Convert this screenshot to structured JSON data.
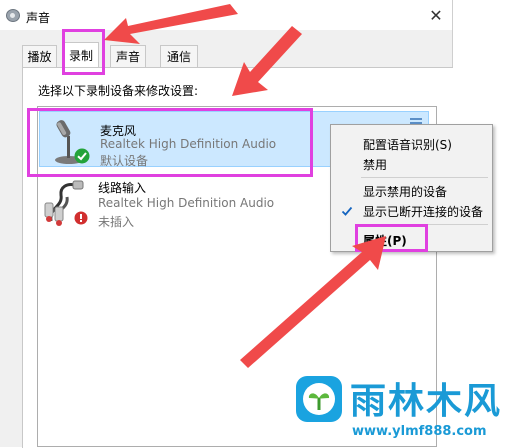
{
  "window": {
    "title": "声音",
    "close_glyph": "✕"
  },
  "tabs": [
    {
      "label": "播放",
      "active": false
    },
    {
      "label": "录制",
      "active": true
    },
    {
      "label": "声音",
      "active": false
    },
    {
      "label": "通信",
      "active": false
    }
  ],
  "instruction": "选择以下录制设备来修改设置:",
  "devices": [
    {
      "name": "麦克风",
      "driver": "Realtek High Definition Audio",
      "status": "默认设备",
      "icon": "microphone-icon",
      "status_icon": "default-check-icon",
      "selected": true
    },
    {
      "name": "线路输入",
      "driver": "Realtek High Definition Audio",
      "status": "未插入",
      "icon": "line-in-cable-icon",
      "status_icon": "unplugged-icon",
      "selected": false
    }
  ],
  "context_menu": {
    "items": [
      {
        "label": "配置语音识别(S)",
        "checked": false,
        "bold": false
      },
      {
        "label": "禁用",
        "checked": false,
        "bold": false
      },
      {
        "label": "显示禁用的设备",
        "checked": false,
        "bold": false
      },
      {
        "label": "显示已断开连接的设备",
        "checked": true,
        "bold": false
      },
      {
        "label": "属性(P)",
        "checked": false,
        "bold": true
      }
    ]
  },
  "watermark": {
    "title": "雨林木风",
    "url": "www.ylmf888.com"
  },
  "colors": {
    "highlight": "#e040e0",
    "arrow": "#f04a4a",
    "selection_bg": "#cce8ff",
    "selection_border": "#99d1ff",
    "watermark": "#1a9ad6"
  }
}
